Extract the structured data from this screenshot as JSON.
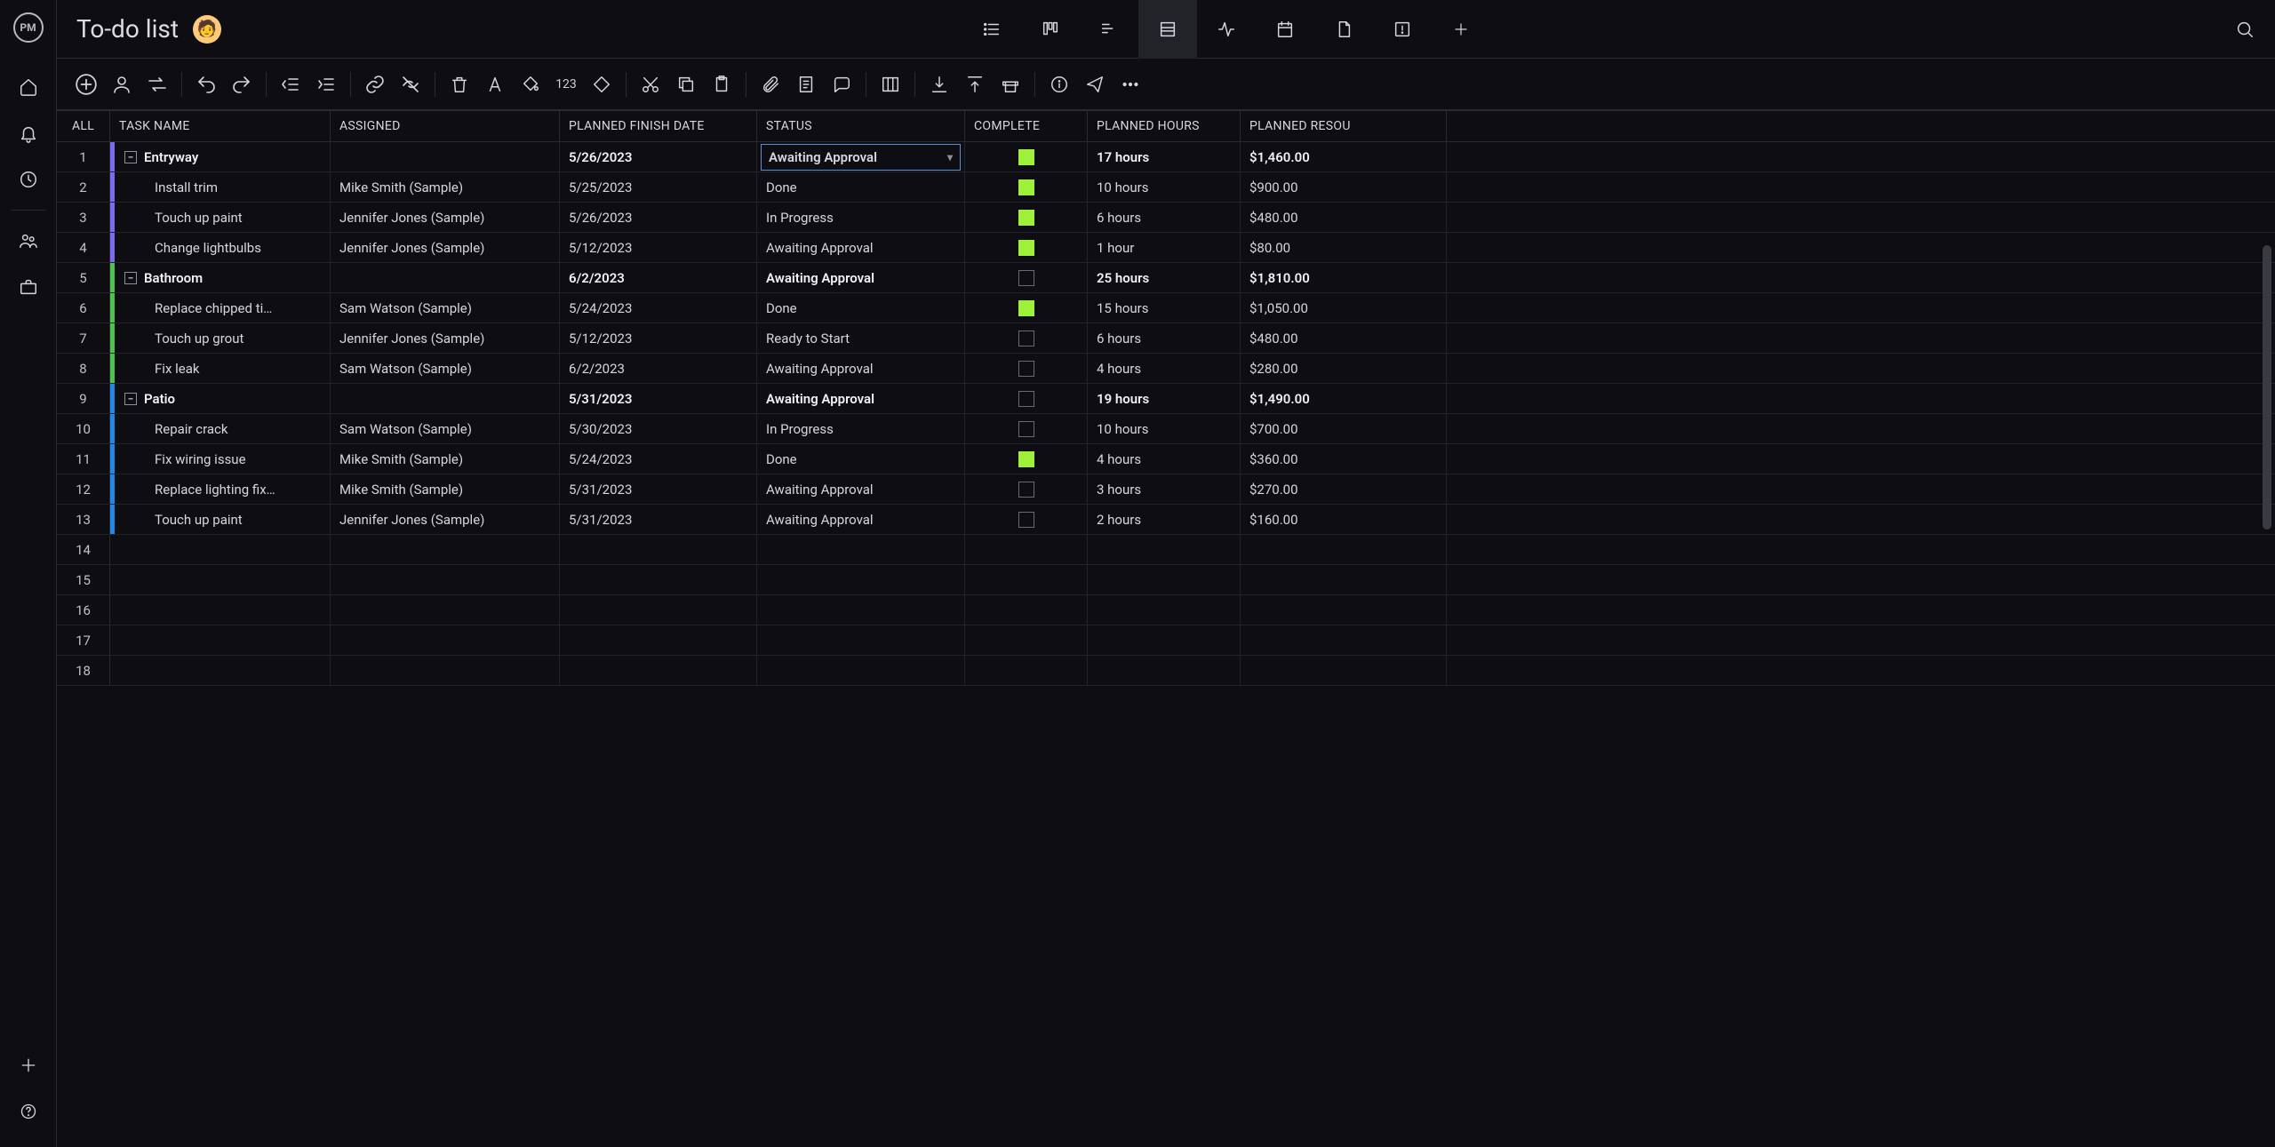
{
  "app": {
    "logo_text": "PM",
    "title": "To-do list"
  },
  "columns": {
    "all": "ALL",
    "task_name": "TASK NAME",
    "assigned": "ASSIGNED",
    "planned_finish": "PLANNED FINISH DATE",
    "status": "STATUS",
    "complete": "COMPLETE",
    "planned_hours": "PLANNED HOURS",
    "planned_resource": "PLANNED RESOU"
  },
  "toolbar": {
    "onetwothree": "123"
  },
  "status_options": [
    "Awaiting Approval",
    "Done",
    "In Progress",
    "Ready to Start"
  ],
  "rows": [
    {
      "n": "1",
      "parent": true,
      "color": "purple",
      "task": "Entryway",
      "assigned": "",
      "finish": "5/26/2023",
      "status": "Awaiting Approval",
      "status_dd": true,
      "complete": true,
      "hours": "17 hours",
      "cost": "$1,460.00"
    },
    {
      "n": "2",
      "parent": false,
      "color": "purple",
      "task": "Install trim",
      "assigned": "Mike Smith (Sample)",
      "finish": "5/25/2023",
      "status": "Done",
      "complete": true,
      "hours": "10 hours",
      "cost": "$900.00"
    },
    {
      "n": "3",
      "parent": false,
      "color": "purple",
      "task": "Touch up paint",
      "assigned": "Jennifer Jones (Sample)",
      "finish": "5/26/2023",
      "status": "In Progress",
      "complete": true,
      "hours": "6 hours",
      "cost": "$480.00"
    },
    {
      "n": "4",
      "parent": false,
      "color": "purple",
      "task": "Change lightbulbs",
      "assigned": "Jennifer Jones (Sample)",
      "finish": "5/12/2023",
      "status": "Awaiting Approval",
      "complete": true,
      "hours": "1 hour",
      "cost": "$80.00"
    },
    {
      "n": "5",
      "parent": true,
      "color": "green",
      "task": "Bathroom",
      "assigned": "",
      "finish": "6/2/2023",
      "status": "Awaiting Approval",
      "complete": false,
      "hours": "25 hours",
      "cost": "$1,810.00"
    },
    {
      "n": "6",
      "parent": false,
      "color": "green",
      "task": "Replace chipped ti…",
      "assigned": "Sam Watson (Sample)",
      "finish": "5/24/2023",
      "status": "Done",
      "complete": true,
      "hours": "15 hours",
      "cost": "$1,050.00"
    },
    {
      "n": "7",
      "parent": false,
      "color": "green",
      "task": "Touch up grout",
      "assigned": "Jennifer Jones (Sample)",
      "finish": "5/12/2023",
      "status": "Ready to Start",
      "complete": false,
      "hours": "6 hours",
      "cost": "$480.00"
    },
    {
      "n": "8",
      "parent": false,
      "color": "green",
      "task": "Fix leak",
      "assigned": "Sam Watson (Sample)",
      "finish": "6/2/2023",
      "status": "Awaiting Approval",
      "complete": false,
      "hours": "4 hours",
      "cost": "$280.00"
    },
    {
      "n": "9",
      "parent": true,
      "color": "blue",
      "task": "Patio",
      "assigned": "",
      "finish": "5/31/2023",
      "status": "Awaiting Approval",
      "complete": false,
      "hours": "19 hours",
      "cost": "$1,490.00"
    },
    {
      "n": "10",
      "parent": false,
      "color": "blue",
      "task": "Repair crack",
      "assigned": "Sam Watson (Sample)",
      "finish": "5/30/2023",
      "status": "In Progress",
      "complete": false,
      "hours": "10 hours",
      "cost": "$700.00"
    },
    {
      "n": "11",
      "parent": false,
      "color": "blue",
      "task": "Fix wiring issue",
      "assigned": "Mike Smith (Sample)",
      "finish": "5/24/2023",
      "status": "Done",
      "complete": true,
      "hours": "4 hours",
      "cost": "$360.00"
    },
    {
      "n": "12",
      "parent": false,
      "color": "blue",
      "task": "Replace lighting fix…",
      "assigned": "Mike Smith (Sample)",
      "finish": "5/31/2023",
      "status": "Awaiting Approval",
      "complete": false,
      "hours": "3 hours",
      "cost": "$270.00"
    },
    {
      "n": "13",
      "parent": false,
      "color": "blue",
      "task": "Touch up paint",
      "assigned": "Jennifer Jones (Sample)",
      "finish": "5/31/2023",
      "status": "Awaiting Approval",
      "complete": false,
      "hours": "2 hours",
      "cost": "$160.00"
    },
    {
      "n": "14",
      "empty": true
    },
    {
      "n": "15",
      "empty": true
    },
    {
      "n": "16",
      "empty": true
    },
    {
      "n": "17",
      "empty": true
    },
    {
      "n": "18",
      "empty": true
    }
  ]
}
